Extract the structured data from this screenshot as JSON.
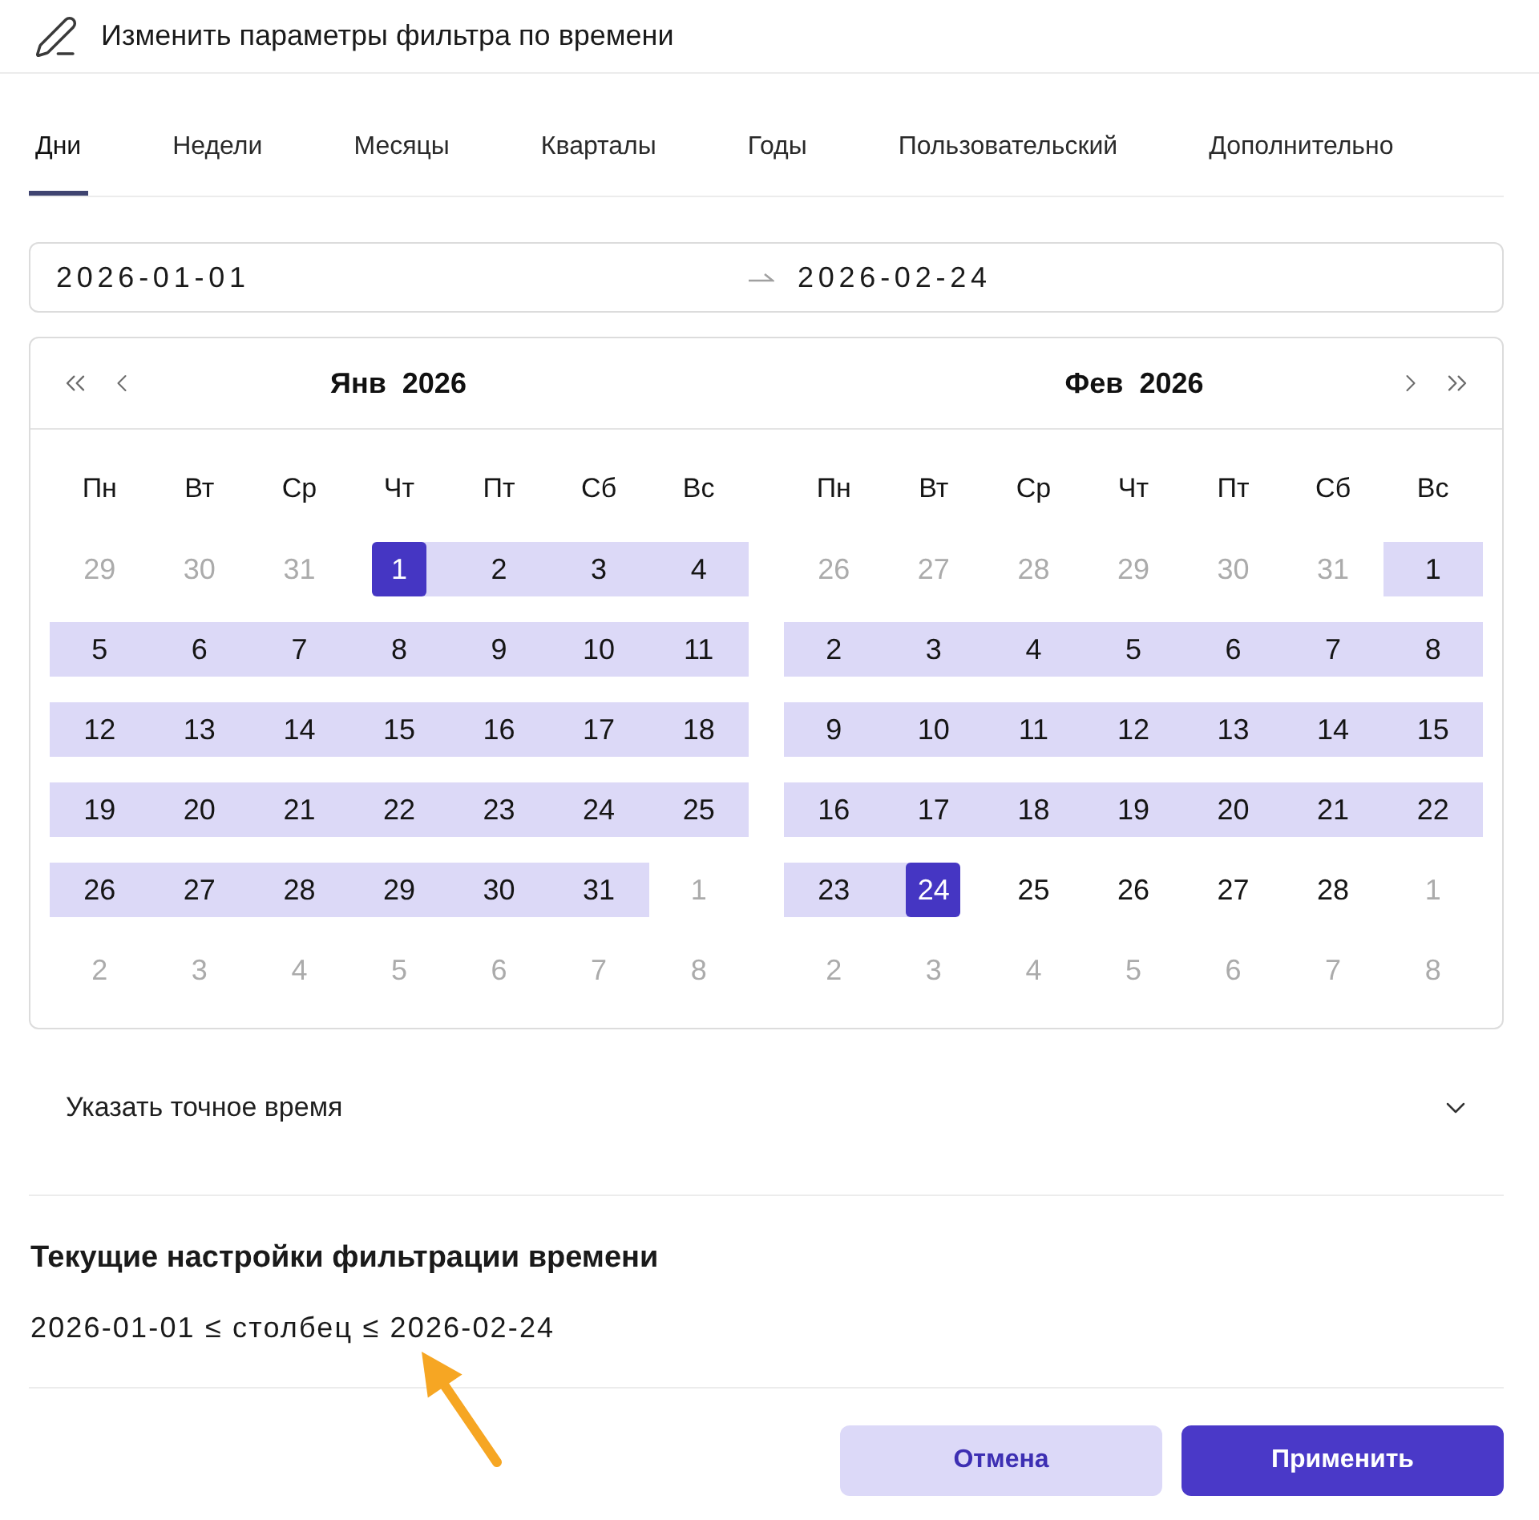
{
  "dialog": {
    "title": "Изменить параметры фильтра по времени"
  },
  "tabs": [
    {
      "label": "Дни",
      "selected": true
    },
    {
      "label": "Недели",
      "selected": false
    },
    {
      "label": "Месяцы",
      "selected": false
    },
    {
      "label": "Кварталы",
      "selected": false
    },
    {
      "label": "Годы",
      "selected": false
    },
    {
      "label": "Пользовательский",
      "selected": false
    },
    {
      "label": "Дополнительно",
      "selected": false
    }
  ],
  "range_input": {
    "start": "2026-01-01",
    "end": "2026-02-24"
  },
  "calendar": {
    "months": [
      {
        "title": "Янв 2026",
        "weekdays": [
          "Пн",
          "Вт",
          "Ср",
          "Чт",
          "Пт",
          "Сб",
          "Вс"
        ],
        "weeks": [
          [
            {
              "day": "29",
              "outside": true,
              "in_range": false,
              "selected": false
            },
            {
              "day": "30",
              "outside": true,
              "in_range": false,
              "selected": false
            },
            {
              "day": "31",
              "outside": true,
              "in_range": false,
              "selected": false
            },
            {
              "day": "1",
              "outside": false,
              "in_range": true,
              "selected": true
            },
            {
              "day": "2",
              "outside": false,
              "in_range": true,
              "selected": false
            },
            {
              "day": "3",
              "outside": false,
              "in_range": true,
              "selected": false
            },
            {
              "day": "4",
              "outside": false,
              "in_range": true,
              "selected": false
            }
          ],
          [
            {
              "day": "5",
              "outside": false,
              "in_range": true,
              "selected": false
            },
            {
              "day": "6",
              "outside": false,
              "in_range": true,
              "selected": false
            },
            {
              "day": "7",
              "outside": false,
              "in_range": true,
              "selected": false
            },
            {
              "day": "8",
              "outside": false,
              "in_range": true,
              "selected": false
            },
            {
              "day": "9",
              "outside": false,
              "in_range": true,
              "selected": false
            },
            {
              "day": "10",
              "outside": false,
              "in_range": true,
              "selected": false
            },
            {
              "day": "11",
              "outside": false,
              "in_range": true,
              "selected": false
            }
          ],
          [
            {
              "day": "12",
              "outside": false,
              "in_range": true,
              "selected": false
            },
            {
              "day": "13",
              "outside": false,
              "in_range": true,
              "selected": false
            },
            {
              "day": "14",
              "outside": false,
              "in_range": true,
              "selected": false
            },
            {
              "day": "15",
              "outside": false,
              "in_range": true,
              "selected": false
            },
            {
              "day": "16",
              "outside": false,
              "in_range": true,
              "selected": false
            },
            {
              "day": "17",
              "outside": false,
              "in_range": true,
              "selected": false
            },
            {
              "day": "18",
              "outside": false,
              "in_range": true,
              "selected": false
            }
          ],
          [
            {
              "day": "19",
              "outside": false,
              "in_range": true,
              "selected": false
            },
            {
              "day": "20",
              "outside": false,
              "in_range": true,
              "selected": false
            },
            {
              "day": "21",
              "outside": false,
              "in_range": true,
              "selected": false
            },
            {
              "day": "22",
              "outside": false,
              "in_range": true,
              "selected": false
            },
            {
              "day": "23",
              "outside": false,
              "in_range": true,
              "selected": false
            },
            {
              "day": "24",
              "outside": false,
              "in_range": true,
              "selected": false
            },
            {
              "day": "25",
              "outside": false,
              "in_range": true,
              "selected": false
            }
          ],
          [
            {
              "day": "26",
              "outside": false,
              "in_range": true,
              "selected": false
            },
            {
              "day": "27",
              "outside": false,
              "in_range": true,
              "selected": false
            },
            {
              "day": "28",
              "outside": false,
              "in_range": true,
              "selected": false
            },
            {
              "day": "29",
              "outside": false,
              "in_range": true,
              "selected": false
            },
            {
              "day": "30",
              "outside": false,
              "in_range": true,
              "selected": false
            },
            {
              "day": "31",
              "outside": false,
              "in_range": true,
              "selected": false
            },
            {
              "day": "1",
              "outside": true,
              "in_range": false,
              "selected": false
            }
          ],
          [
            {
              "day": "2",
              "outside": true,
              "in_range": false,
              "selected": false
            },
            {
              "day": "3",
              "outside": true,
              "in_range": false,
              "selected": false
            },
            {
              "day": "4",
              "outside": true,
              "in_range": false,
              "selected": false
            },
            {
              "day": "5",
              "outside": true,
              "in_range": false,
              "selected": false
            },
            {
              "day": "6",
              "outside": true,
              "in_range": false,
              "selected": false
            },
            {
              "day": "7",
              "outside": true,
              "in_range": false,
              "selected": false
            },
            {
              "day": "8",
              "outside": true,
              "in_range": false,
              "selected": false
            }
          ]
        ]
      },
      {
        "title": "Фев 2026",
        "weekdays": [
          "Пн",
          "Вт",
          "Ср",
          "Чт",
          "Пт",
          "Сб",
          "Вс"
        ],
        "weeks": [
          [
            {
              "day": "26",
              "outside": true,
              "in_range": false,
              "selected": false
            },
            {
              "day": "27",
              "outside": true,
              "in_range": false,
              "selected": false
            },
            {
              "day": "28",
              "outside": true,
              "in_range": false,
              "selected": false
            },
            {
              "day": "29",
              "outside": true,
              "in_range": false,
              "selected": false
            },
            {
              "day": "30",
              "outside": true,
              "in_range": false,
              "selected": false
            },
            {
              "day": "31",
              "outside": true,
              "in_range": false,
              "selected": false
            },
            {
              "day": "1",
              "outside": false,
              "in_range": true,
              "selected": false
            }
          ],
          [
            {
              "day": "2",
              "outside": false,
              "in_range": true,
              "selected": false
            },
            {
              "day": "3",
              "outside": false,
              "in_range": true,
              "selected": false
            },
            {
              "day": "4",
              "outside": false,
              "in_range": true,
              "selected": false
            },
            {
              "day": "5",
              "outside": false,
              "in_range": true,
              "selected": false
            },
            {
              "day": "6",
              "outside": false,
              "in_range": true,
              "selected": false
            },
            {
              "day": "7",
              "outside": false,
              "in_range": true,
              "selected": false
            },
            {
              "day": "8",
              "outside": false,
              "in_range": true,
              "selected": false
            }
          ],
          [
            {
              "day": "9",
              "outside": false,
              "in_range": true,
              "selected": false
            },
            {
              "day": "10",
              "outside": false,
              "in_range": true,
              "selected": false
            },
            {
              "day": "11",
              "outside": false,
              "in_range": true,
              "selected": false
            },
            {
              "day": "12",
              "outside": false,
              "in_range": true,
              "selected": false
            },
            {
              "day": "13",
              "outside": false,
              "in_range": true,
              "selected": false
            },
            {
              "day": "14",
              "outside": false,
              "in_range": true,
              "selected": false
            },
            {
              "day": "15",
              "outside": false,
              "in_range": true,
              "selected": false
            }
          ],
          [
            {
              "day": "16",
              "outside": false,
              "in_range": true,
              "selected": false
            },
            {
              "day": "17",
              "outside": false,
              "in_range": true,
              "selected": false
            },
            {
              "day": "18",
              "outside": false,
              "in_range": true,
              "selected": false
            },
            {
              "day": "19",
              "outside": false,
              "in_range": true,
              "selected": false
            },
            {
              "day": "20",
              "outside": false,
              "in_range": true,
              "selected": false
            },
            {
              "day": "21",
              "outside": false,
              "in_range": true,
              "selected": false
            },
            {
              "day": "22",
              "outside": false,
              "in_range": true,
              "selected": false
            }
          ],
          [
            {
              "day": "23",
              "outside": false,
              "in_range": true,
              "selected": false
            },
            {
              "day": "24",
              "outside": false,
              "in_range": true,
              "selected": true
            },
            {
              "day": "25",
              "outside": false,
              "in_range": false,
              "selected": false
            },
            {
              "day": "26",
              "outside": false,
              "in_range": false,
              "selected": false
            },
            {
              "day": "27",
              "outside": false,
              "in_range": false,
              "selected": false
            },
            {
              "day": "28",
              "outside": false,
              "in_range": false,
              "selected": false
            },
            {
              "day": "1",
              "outside": true,
              "in_range": false,
              "selected": false
            }
          ],
          [
            {
              "day": "2",
              "outside": true,
              "in_range": false,
              "selected": false
            },
            {
              "day": "3",
              "outside": true,
              "in_range": false,
              "selected": false
            },
            {
              "day": "4",
              "outside": true,
              "in_range": false,
              "selected": false
            },
            {
              "day": "5",
              "outside": true,
              "in_range": false,
              "selected": false
            },
            {
              "day": "6",
              "outside": true,
              "in_range": false,
              "selected": false
            },
            {
              "day": "7",
              "outside": true,
              "in_range": false,
              "selected": false
            },
            {
              "day": "8",
              "outside": true,
              "in_range": false,
              "selected": false
            }
          ]
        ]
      }
    ]
  },
  "exact_time": {
    "label": "Указать точное время",
    "expanded": false
  },
  "current_settings": {
    "title": "Текущие настройки фильтрации времени",
    "summary": "2026-01-01 ≤ столбец ≤ 2026-02-24"
  },
  "buttons": [
    {
      "label": "Отмена",
      "kind": "secondary"
    },
    {
      "label": "Применить",
      "kind": "primary"
    }
  ]
}
